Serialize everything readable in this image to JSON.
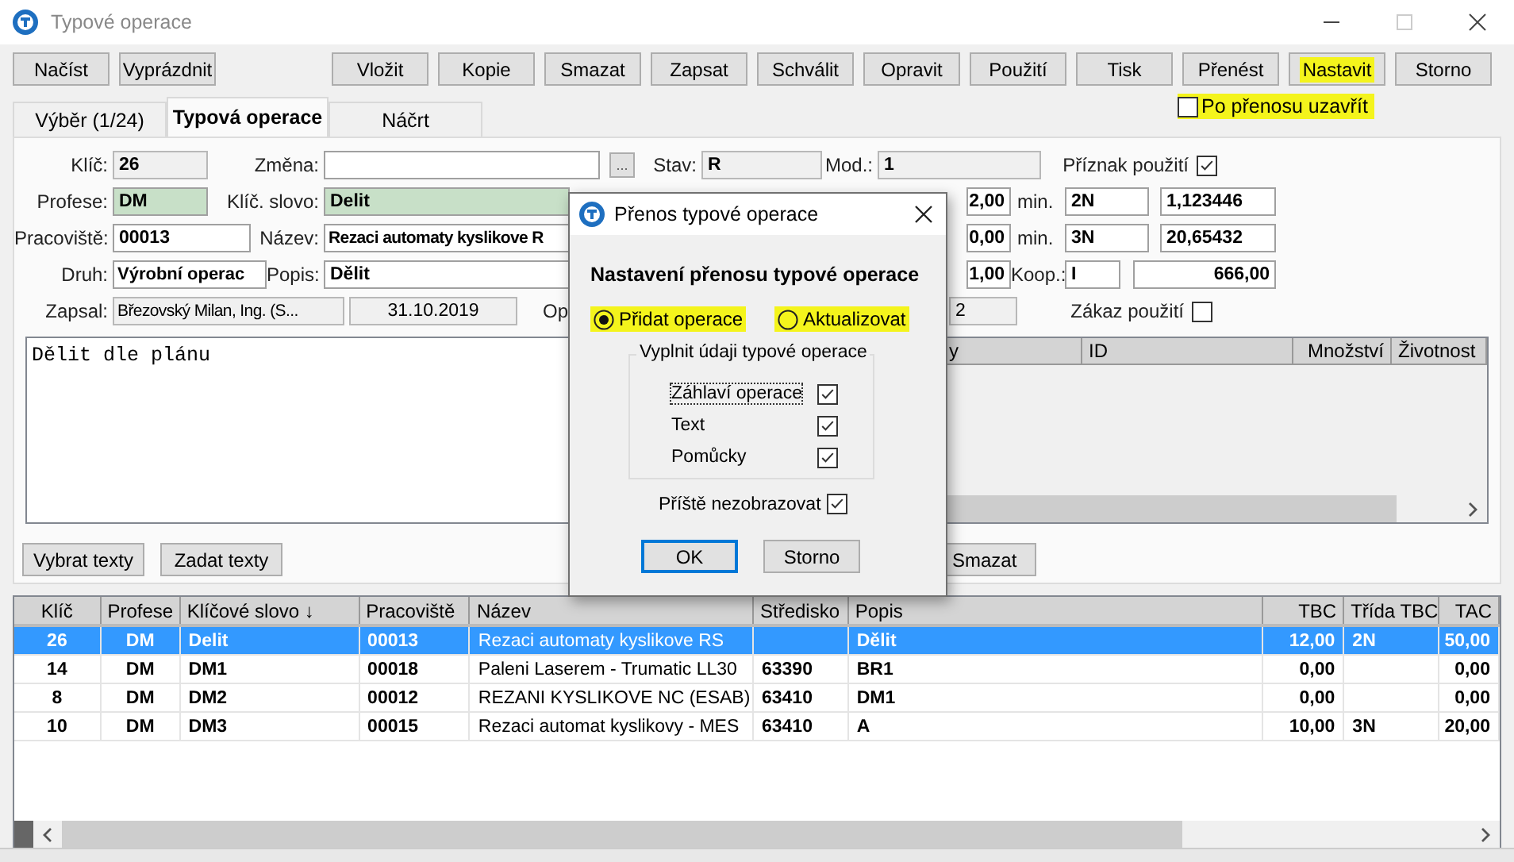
{
  "window": {
    "title": "Typové operace"
  },
  "toolbar": [
    {
      "label": "Načíst",
      "highlighted": false
    },
    {
      "label": "Vyprázdnit",
      "highlighted": false
    },
    {
      "label": "Vložit",
      "highlighted": false
    },
    {
      "label": "Kopie",
      "highlighted": false
    },
    {
      "label": "Smazat",
      "highlighted": false
    },
    {
      "label": "Zapsat",
      "highlighted": false
    },
    {
      "label": "Schválit",
      "highlighted": false
    },
    {
      "label": "Opravit",
      "highlighted": false
    },
    {
      "label": "Použití",
      "highlighted": false
    },
    {
      "label": "Tisk",
      "highlighted": false
    },
    {
      "label": "Přenést",
      "highlighted": false
    },
    {
      "label": "Nastavit",
      "highlighted": true
    },
    {
      "label": "Storno",
      "highlighted": false
    }
  ],
  "close_after_transfer": {
    "label": "Po přenosu uzavřít",
    "checked": false,
    "highlighted": true
  },
  "tabs": [
    {
      "label": "Výběr (1/24)",
      "selected": false
    },
    {
      "label": "Typová operace",
      "selected": true
    },
    {
      "label": "Náčrt",
      "selected": false
    }
  ],
  "form": {
    "key": {
      "label": "Klíč:",
      "value": "26"
    },
    "change": {
      "label": "Změna:"
    },
    "browse_button": "...",
    "state": {
      "label": "Stav:",
      "value": "R"
    },
    "mod": {
      "label": "Mod.:",
      "value": "1"
    },
    "usage_flag": {
      "label": "Příznak použití",
      "checked": true
    },
    "profession": {
      "label": "Profese:",
      "value": "DM"
    },
    "keyword": {
      "label": "Klíč. slovo:",
      "value": "Delit"
    },
    "time_1": "2,00",
    "unit_1": "min.",
    "class_1": "2N",
    "value_1": "1,123446",
    "workplace": {
      "label": "Pracoviště:",
      "value": "00013"
    },
    "name": {
      "label": "Název:",
      "value": "Rezaci automaty kyslikove R"
    },
    "time_2": "0,00",
    "unit_2": "min.",
    "class_2": "3N",
    "value_2": "20,65432",
    "type": {
      "label": "Druh:",
      "value": "Výrobní operac"
    },
    "description": {
      "label": "Popis:",
      "value": "Dělit"
    },
    "time_3": "1,00",
    "coop": {
      "label": "Koop.:",
      "value": "I"
    },
    "coop_value": "666,00",
    "author": {
      "label": "Zapsal:",
      "value": "Březovský Milan, Ing. (S..."
    },
    "date": "31.10.2019",
    "label_5": "Op",
    "field_5": "2",
    "ban_usage": {
      "label": "Zákaz použití",
      "checked": false
    },
    "note": "Dělit dle plánu"
  },
  "tools_table": {
    "columns": [
      "y",
      "ID",
      "Množství",
      "Životnost"
    ]
  },
  "text_buttons": [
    "Vybrat texty",
    "Zadat texty"
  ],
  "delete_button": "Smazat",
  "table": {
    "columns": [
      "Klíč",
      "Profese",
      "Klíčové slovo ↓",
      "Pracoviště",
      "Název",
      "Středisko",
      "Popis",
      "TBC",
      "Třída TBC",
      "TAC"
    ],
    "rows": [
      {
        "selected": true,
        "cells": [
          "26",
          "DM",
          "Delit",
          "00013",
          "Rezaci automaty kyslikove RS",
          null,
          "Dělit",
          "12,00",
          "2N",
          "50,00"
        ]
      },
      {
        "selected": false,
        "cells": [
          "14",
          "DM",
          "DM1",
          "00018",
          "Paleni Laserem - Trumatic LL30",
          "63390",
          "BR1",
          "0,00",
          null,
          "0,00"
        ]
      },
      {
        "selected": false,
        "cells": [
          "8",
          "DM",
          "DM2",
          "00012",
          "REZANI KYSLIKOVE NC (ESAB)",
          "63410",
          "DM1",
          "0,00",
          null,
          "0,00"
        ]
      },
      {
        "selected": false,
        "cells": [
          "10",
          "DM",
          "DM3",
          "00015",
          "Rezaci automat kyslikovy - MES",
          "63410",
          "A",
          "10,00",
          "3N",
          "20,00"
        ]
      }
    ]
  },
  "dialog": {
    "title": "Přenos typové operace",
    "heading": "Nastavení přenosu typové operace",
    "modes": [
      {
        "label": "Přidat operace",
        "selected": true,
        "highlighted": true
      },
      {
        "label": "Aktualizovat",
        "selected": false,
        "highlighted": true
      }
    ],
    "group": {
      "legend": "Vyplnit údaji typové operace",
      "items": [
        {
          "label": "Záhlaví operace",
          "checked": true,
          "focused": true
        },
        {
          "label": "Text",
          "checked": true,
          "focused": false
        },
        {
          "label": "Pomůcky",
          "checked": true,
          "focused": false
        }
      ]
    },
    "dont_show": {
      "label": "Příště nezobrazovat",
      "checked": true
    },
    "buttons": [
      {
        "label": "OK",
        "default": true
      },
      {
        "label": "Storno",
        "default": false
      }
    ]
  }
}
